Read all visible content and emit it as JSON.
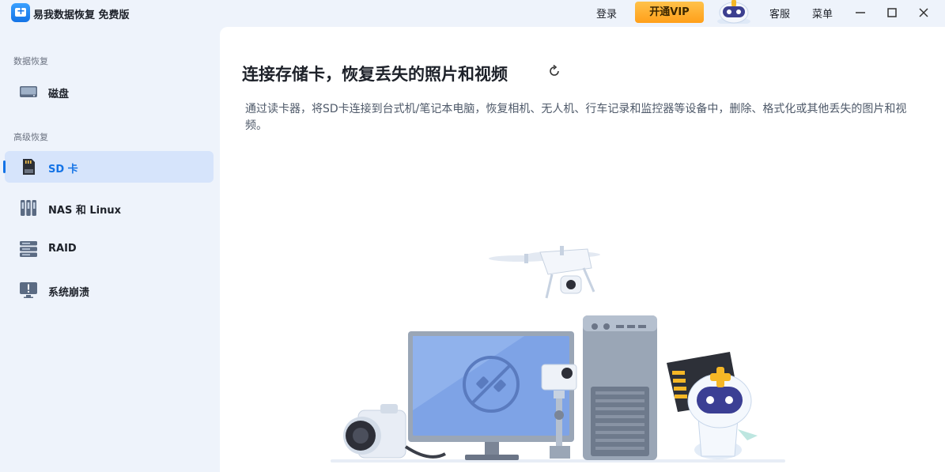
{
  "app": {
    "title": "易我数据恢复 免费版"
  },
  "titlebar": {
    "login": "登录",
    "vip": "开通VIP",
    "support": "客服",
    "menu": "菜单"
  },
  "sidebar": {
    "section_data_recovery": "数据恢复",
    "section_advanced": "高级恢复",
    "items": [
      {
        "label": "磁盘",
        "icon": "disk-icon"
      },
      {
        "label": "SD 卡",
        "icon": "sd-card-icon",
        "active": true
      },
      {
        "label": "NAS 和 Linux",
        "icon": "nas-icon"
      },
      {
        "label": "RAID",
        "icon": "raid-icon"
      },
      {
        "label": "系统崩溃",
        "icon": "system-crash-icon"
      }
    ]
  },
  "main": {
    "title": "连接存储卡，恢复丢失的照片和视频",
    "description": "通过读卡器，将SD卡连接到台式机/笔记本电脑，恢复相机、无人机、行车记录和监控器等设备中，删除、格式化或其他丢失的图片和视频。"
  },
  "colors": {
    "accent": "#1473e6",
    "vip": "#ffb02e",
    "sidebar_bg": "#eef3fb"
  }
}
